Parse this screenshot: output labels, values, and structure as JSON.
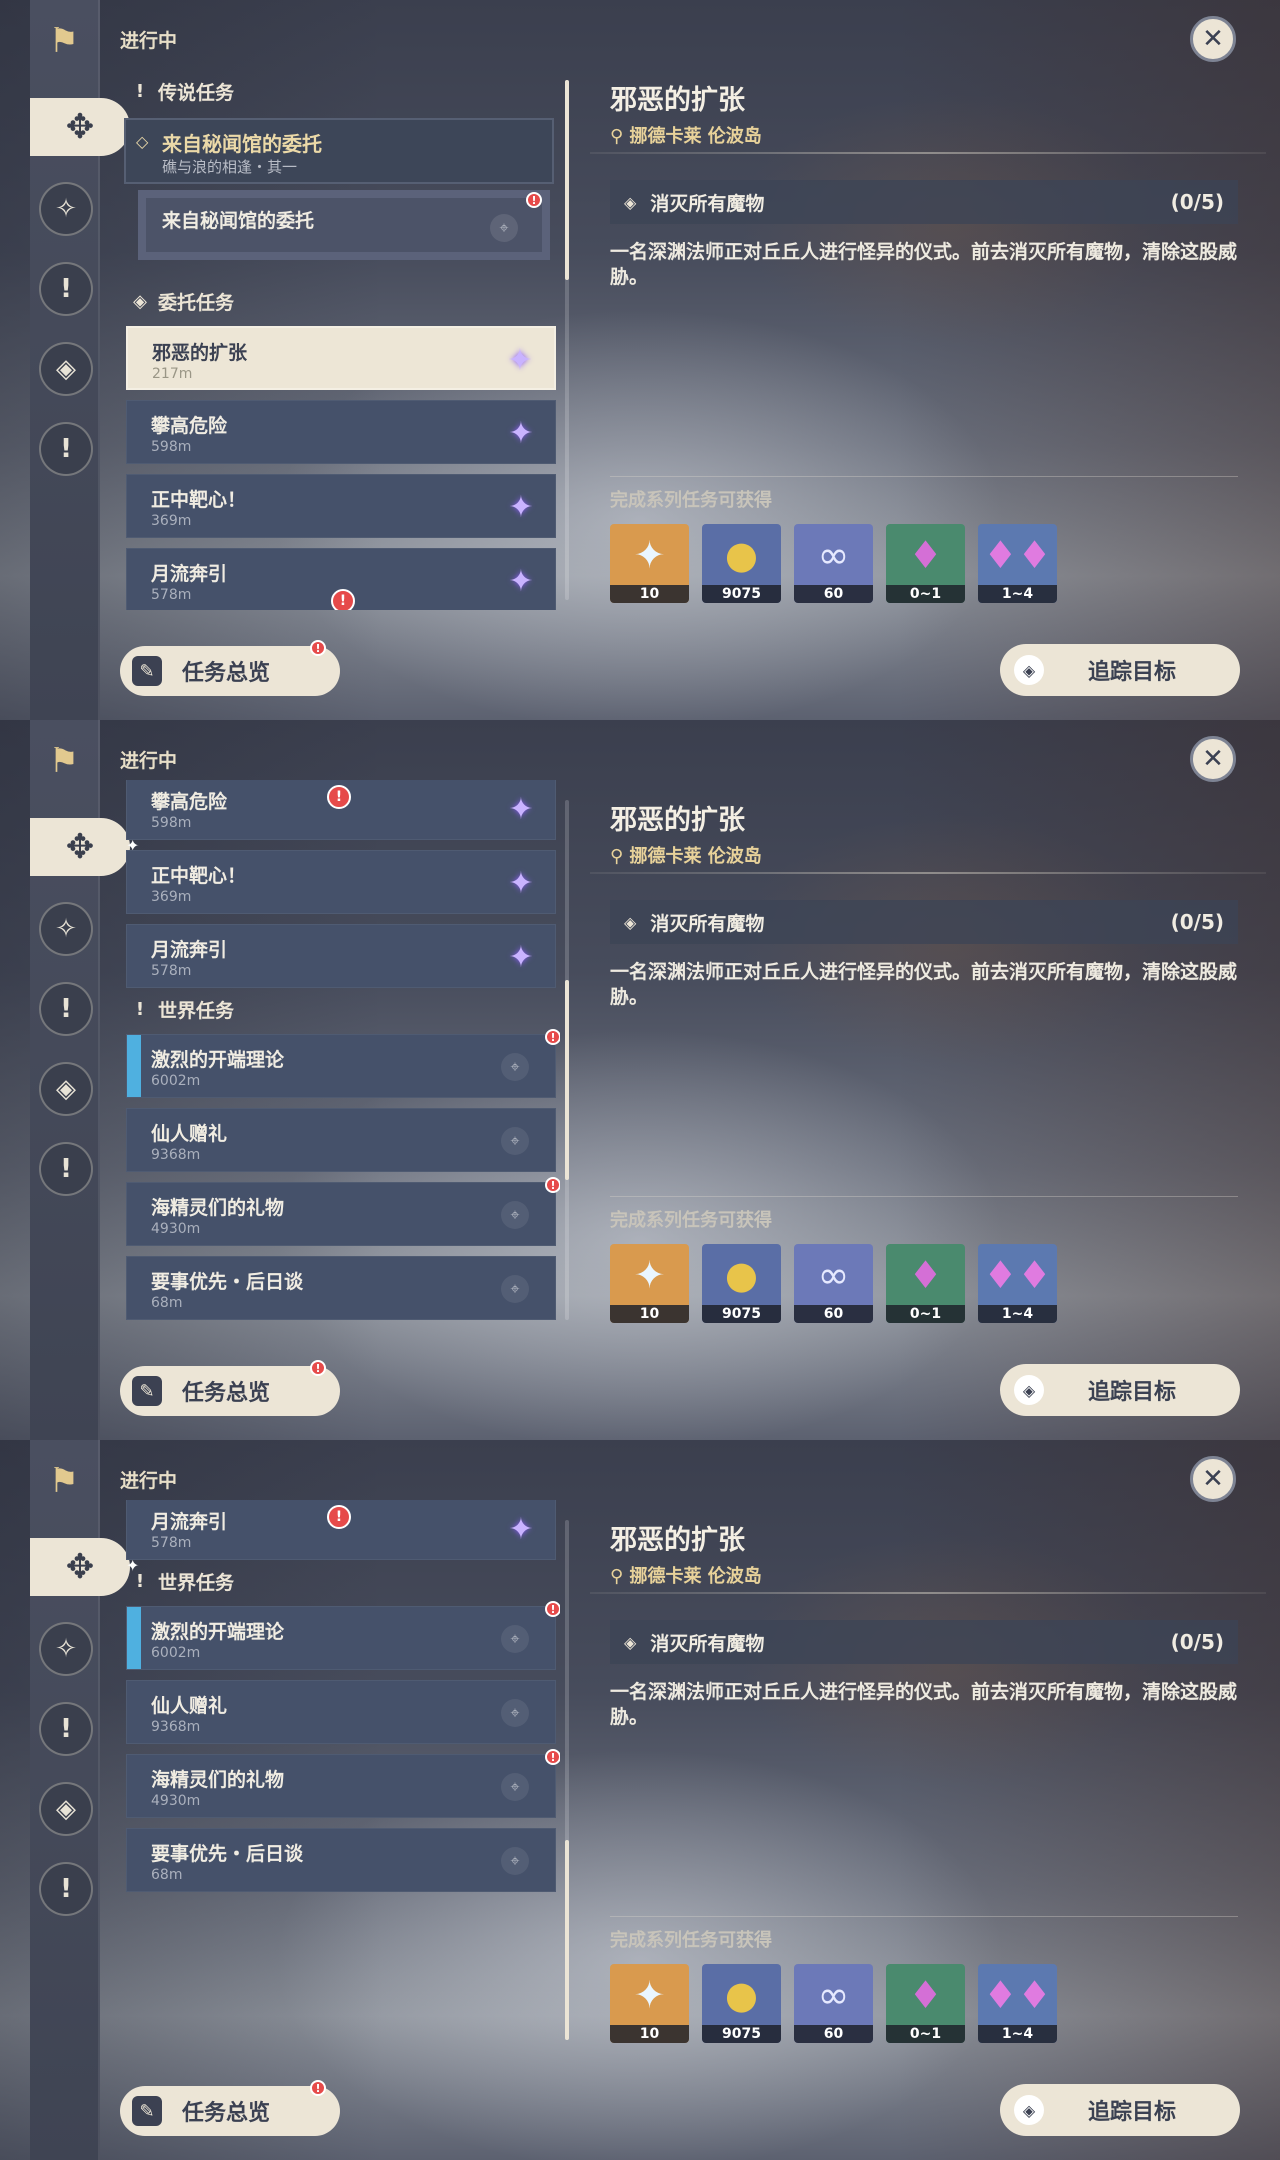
{
  "header": {
    "in_progress": "进行中"
  },
  "sections": {
    "legend": "传说任务",
    "commission": "委托任务",
    "world": "世界任务"
  },
  "legend_quest": {
    "title": "来自秘闻馆的委托",
    "subtitle": "礁与浪的相逢・其一",
    "sub_item": "来自秘闻馆的委托"
  },
  "commissions": [
    {
      "title": "邪恶的扩张",
      "distance": "217m"
    },
    {
      "title": "攀高危险",
      "distance": "598m"
    },
    {
      "title": "正中靶心！",
      "distance": "369m"
    },
    {
      "title": "月流奔引",
      "distance": "578m"
    }
  ],
  "world_quests": [
    {
      "title": "激烈的开端理论",
      "distance": "6002m"
    },
    {
      "title": "仙人赠礼",
      "distance": "9368m"
    },
    {
      "title": "海精灵们的礼物",
      "distance": "4930m"
    },
    {
      "title": "要事优先・后日谈",
      "distance": "68m"
    }
  ],
  "buttons": {
    "overview": "任务总览",
    "track": "追踪目标"
  },
  "detail": {
    "title": "邪恶的扩张",
    "location": "挪德卡莱 伦波岛",
    "objective": "消灭所有魔物",
    "progress": "(0/5)",
    "description": "一名深渊法师正对丘丘人进行怪异的仪式。前去消灭所有魔物，清除这股威胁。",
    "rewards_label": "完成系列任务可获得",
    "rewards": [
      {
        "icon": "primogem-icon",
        "qty": "10",
        "color": "#d99a4e"
      },
      {
        "icon": "mora-icon",
        "qty": "9075",
        "color": "#5a6ea6"
      },
      {
        "icon": "friendship-exp-icon",
        "qty": "60",
        "color": "#6c79b8"
      },
      {
        "icon": "crystal-icon",
        "qty": "0~1",
        "color": "#4a8a6e"
      },
      {
        "icon": "crystal-cluster-icon",
        "qty": "1~4",
        "color": "#5c79b0"
      }
    ]
  }
}
